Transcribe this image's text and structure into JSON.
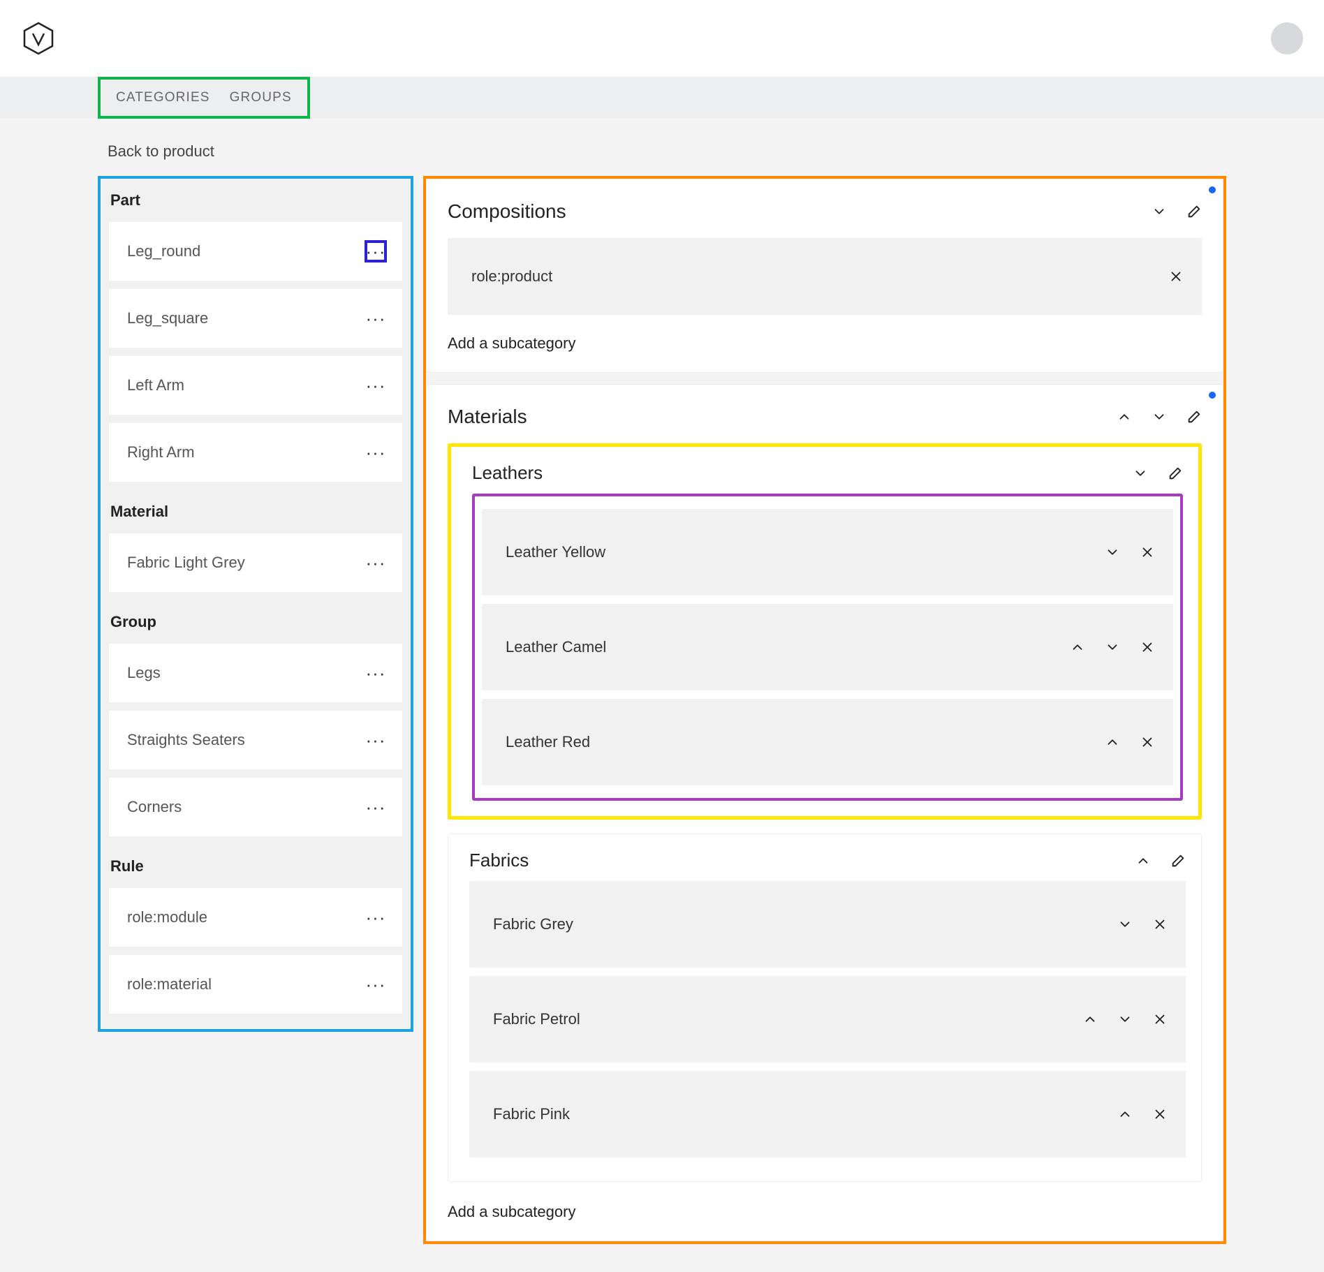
{
  "tabs": {
    "categories": "CATEGORIES",
    "groups": "GROUPS"
  },
  "back_link": "Back to product",
  "sidebar": {
    "sections": [
      {
        "title": "Part",
        "items": [
          {
            "label": "Leg_round",
            "dots_highlight": true
          },
          {
            "label": "Leg_square"
          },
          {
            "label": "Left Arm"
          },
          {
            "label": "Right Arm"
          }
        ]
      },
      {
        "title": "Material",
        "items": [
          {
            "label": "Fabric Light Grey"
          }
        ]
      },
      {
        "title": "Group",
        "items": [
          {
            "label": "Legs"
          },
          {
            "label": "Straights Seaters"
          },
          {
            "label": "Corners"
          }
        ]
      },
      {
        "title": "Rule",
        "items": [
          {
            "label": "role:module"
          },
          {
            "label": "role:material"
          }
        ]
      }
    ]
  },
  "main": {
    "panels": [
      {
        "title": "Compositions",
        "blue_dot": true,
        "head_actions": [
          "down",
          "edit"
        ],
        "chips": [
          {
            "label": "role:product",
            "actions": [
              "close"
            ]
          }
        ],
        "add_label": "Add a subcategory"
      },
      {
        "title": "Materials",
        "blue_dot": true,
        "head_actions": [
          "up",
          "down",
          "edit"
        ],
        "subcats": [
          {
            "title": "Leathers",
            "head_actions": [
              "down",
              "edit"
            ],
            "highlight": "yellow+purple",
            "items": [
              {
                "label": "Leather Yellow",
                "actions": [
                  "down",
                  "close"
                ]
              },
              {
                "label": "Leather Camel",
                "actions": [
                  "up",
                  "down",
                  "close"
                ]
              },
              {
                "label": "Leather Red",
                "actions": [
                  "up",
                  "close"
                ]
              }
            ]
          },
          {
            "title": "Fabrics",
            "head_actions": [
              "up",
              "edit"
            ],
            "items": [
              {
                "label": "Fabric Grey",
                "actions": [
                  "down",
                  "close"
                ]
              },
              {
                "label": "Fabric Petrol",
                "actions": [
                  "up",
                  "down",
                  "close"
                ]
              },
              {
                "label": "Fabric Pink",
                "actions": [
                  "up",
                  "close"
                ]
              }
            ]
          }
        ],
        "add_label": "Add a subcategory"
      }
    ]
  }
}
